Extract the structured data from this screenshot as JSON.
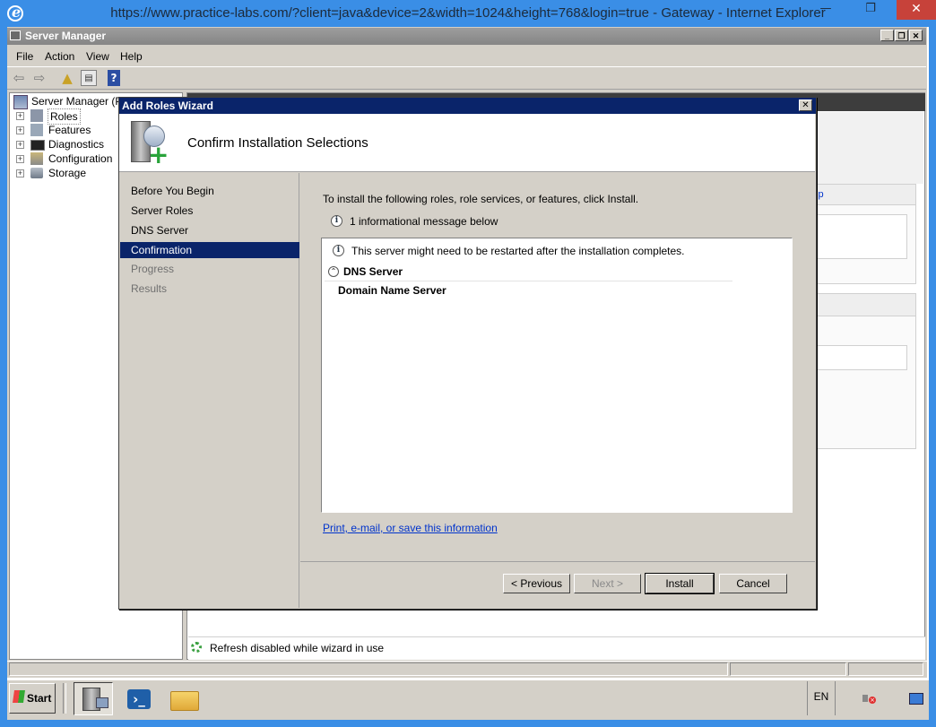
{
  "browser": {
    "title": "https://www.practice-labs.com/?client=java&device=2&width=1024&height=768&login=true - Gateway  - Internet Explorer"
  },
  "server_manager": {
    "title": "Server Manager",
    "menus": [
      "File",
      "Action",
      "View",
      "Help"
    ],
    "tree": {
      "root": "Server Manager (PL",
      "items": [
        "Roles",
        "Features",
        "Diagnostics",
        "Configuration",
        "Storage"
      ]
    },
    "right_fragments": [
      "lp"
    ],
    "status_text": "Refresh disabled while wizard in use"
  },
  "wizard": {
    "title": "Add Roles Wizard",
    "heading": "Confirm Installation Selections",
    "nav": [
      "Before You Begin",
      "Server Roles",
      "DNS Server",
      "Confirmation",
      "Progress",
      "Results"
    ],
    "intro": "To install the following roles, role services, or features, click Install.",
    "info_count": "1 informational message below",
    "message": "This server might need to be restarted after the installation completes.",
    "section_title": "DNS Server",
    "section_item": "Domain Name Server",
    "link": "Print, e-mail, or save this information",
    "buttons": {
      "previous": "< Previous",
      "next": "Next >",
      "install": "Install",
      "cancel": "Cancel"
    }
  },
  "taskbar": {
    "start": "Start",
    "language": "EN"
  }
}
